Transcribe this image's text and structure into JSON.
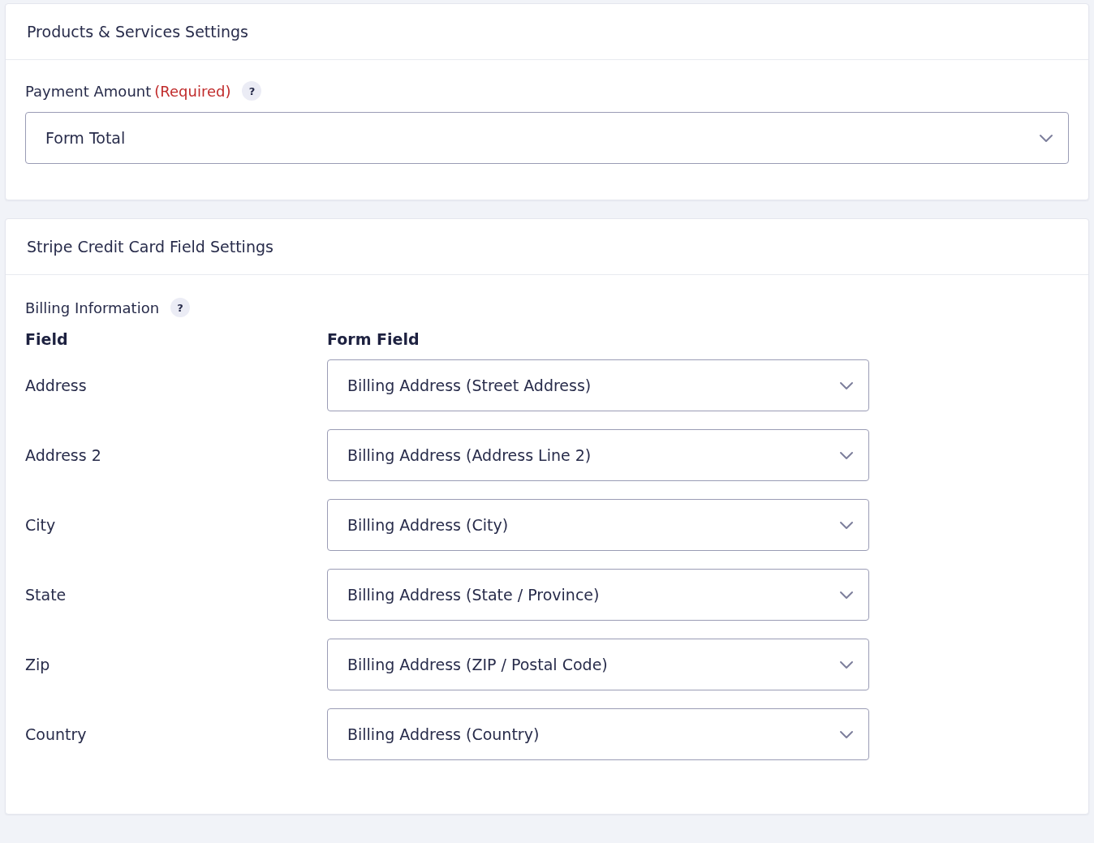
{
  "products_panel": {
    "title": "Products & Services Settings",
    "payment_amount": {
      "label": "Payment Amount",
      "required_note": "(Required)",
      "help": "?",
      "value": "Form Total"
    }
  },
  "stripe_panel": {
    "title": "Stripe Credit Card Field Settings",
    "billing": {
      "label": "Billing Information",
      "help": "?"
    },
    "columns": [
      "Field",
      "Form Field"
    ],
    "rows": [
      {
        "field": "Address",
        "value": "Billing Address (Street Address)"
      },
      {
        "field": "Address 2",
        "value": "Billing Address (Address Line 2)"
      },
      {
        "field": "City",
        "value": "Billing Address (City)"
      },
      {
        "field": "State",
        "value": "Billing Address (State / Province)"
      },
      {
        "field": "Zip",
        "value": "Billing Address (ZIP / Postal Code)"
      },
      {
        "field": "Country",
        "value": "Billing Address (Country)"
      }
    ]
  }
}
